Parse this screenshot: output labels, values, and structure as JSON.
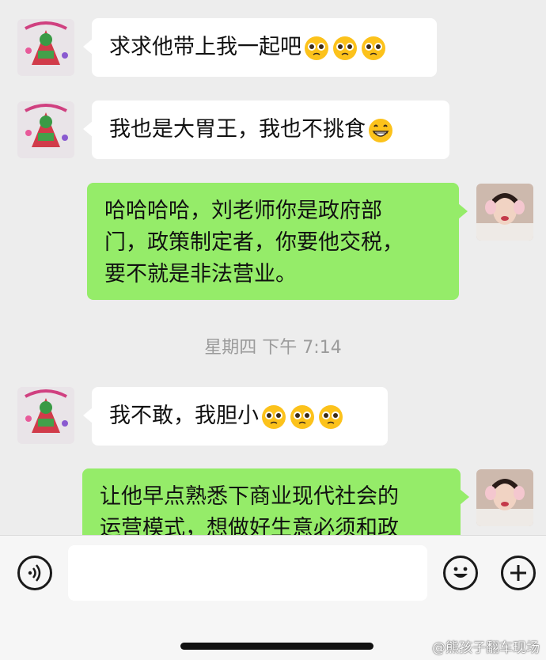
{
  "messages": [
    {
      "side": "left",
      "text": "求求他带上我一起吧",
      "emoji": [
        "pleading-face",
        "pleading-face",
        "pleading-face"
      ]
    },
    {
      "side": "left",
      "text": "我也是大胃王，我也不挑食",
      "emoji": [
        "grinning-face"
      ]
    },
    {
      "side": "right",
      "text": "哈哈哈哈，刘老师你是政府部门，政策制定者，你要他交税，要不就是非法营业。",
      "lines": [
        "哈哈哈哈，刘老师你是政府部",
        "门，政策制定者，你要他交税，",
        "要不就是非法营业。"
      ]
    },
    {
      "side": "left",
      "text": "我不敢，我胆小",
      "emoji": [
        "pleading-face",
        "pleading-face",
        "pleading-face"
      ]
    },
    {
      "side": "right",
      "text": "让他早点熟悉下商业现代社会的运营模式，想做好生意必须和政",
      "lines": [
        "让他早点熟悉下商业现代社会的",
        "运营模式，想做好生意必须和政"
      ]
    }
  ],
  "timestamp": "星期四 下午 7:14",
  "watermark": "@熊孩子翻车现场",
  "colors": {
    "background": "#ededed",
    "sent_bubble": "#95ec69",
    "received_bubble": "#ffffff"
  },
  "icons": {
    "voice": "voice-icon",
    "emoji": "emoji-icon",
    "more": "plus-icon"
  }
}
